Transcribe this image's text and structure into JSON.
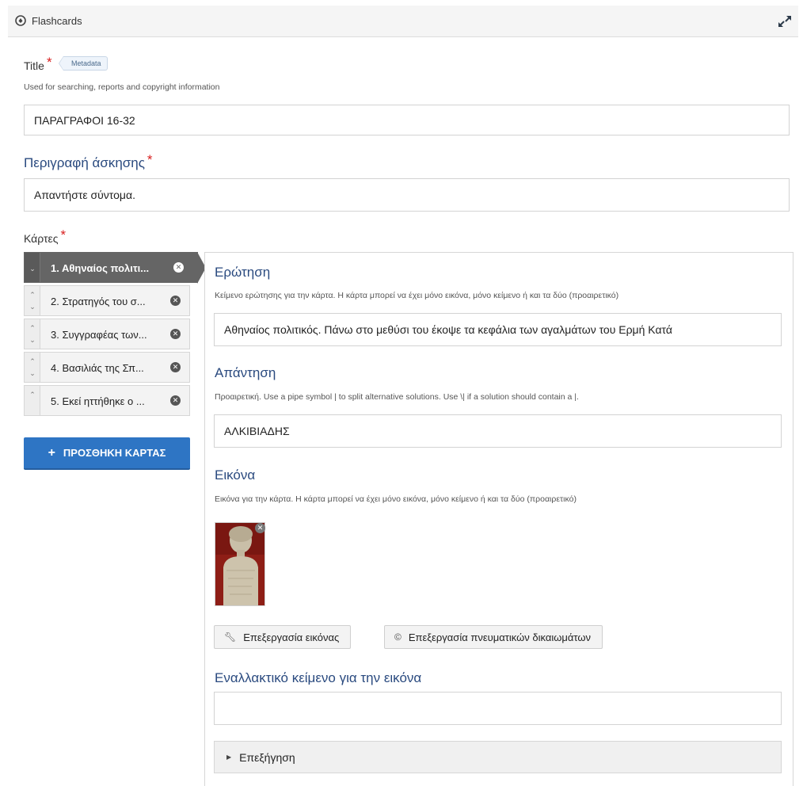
{
  "header": {
    "title": "Flashcards",
    "app_icon": "h5p-flashcards-icon",
    "fullscreen_icon": "expand-icon"
  },
  "title_field": {
    "label": "Title",
    "required_mark": "*",
    "metadata_tag": "Metadata",
    "description": "Used for searching, reports and copyright information",
    "value": "ΠΑΡΑΓΡΑΦΟΙ 16-32"
  },
  "task_description": {
    "label": "Περιγραφή άσκησης",
    "required_mark": "*",
    "value": "Απαντήστε σύντομα."
  },
  "cards": {
    "label": "Κάρτες",
    "required_mark": "*",
    "items": [
      {
        "label": "1. Αθηναίος πολιτι...",
        "active": true
      },
      {
        "label": "2. Στρατηγός του σ...",
        "active": false
      },
      {
        "label": "3. Συγγραφέας των...",
        "active": false
      },
      {
        "label": "4. Βασιλιάς της Σπ...",
        "active": false
      },
      {
        "label": "5. Εκεί ηττήθηκε ο ...",
        "active": false
      }
    ],
    "add_button": "ΠΡΟΣΘΗΚΗ ΚΑΡΤΑΣ",
    "add_icon": "+"
  },
  "card_editor": {
    "question": {
      "label": "Ερώτηση",
      "description": "Κείμενο ερώτησης για την κάρτα. Η κάρτα μπορεί να έχει μόνο εικόνα, μόνο κείμενο ή και τα δύο (προαιρετικό)",
      "value": "Αθηναίος πολιτικός. Πάνω στο μεθύσι του έκοψε τα κεφάλια των αγαλμάτων του Ερμή  Κατά"
    },
    "answer": {
      "label": "Απάντηση",
      "description": "Προαιρετική. Use a pipe symbol | to split alternative solutions. Use \\| if a solution should contain a |.",
      "value": "ΑΛΚΙΒΙΑΔΗΣ"
    },
    "image": {
      "label": "Εικόνα",
      "description": "Εικόνα για την κάρτα. Η κάρτα μπορεί να έχει μόνο εικόνα, μόνο κείμενο ή και τα δύο (προαιρετικό)",
      "edit_button": "Επεξεργασία εικόνας",
      "copyright_button": "Επεξεργασία πνευματικών δικαιωμάτων",
      "edit_icon": "wrench-icon",
      "copyright_icon": "copyright-icon"
    },
    "alt_text": {
      "label": "Εναλλακτικό κείμενο για την εικόνα",
      "value": ""
    },
    "tip": {
      "label": "Επεξήγηση"
    }
  },
  "colors": {
    "accent_blue": "#2e75c4",
    "heading_blue": "#2a4a7f",
    "active_card": "#656565",
    "required": "#d81e1e"
  }
}
